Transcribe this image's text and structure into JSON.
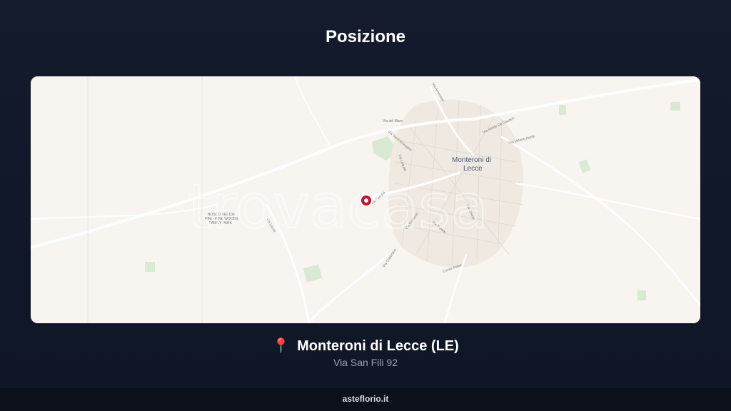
{
  "header": {
    "title": "Posizione"
  },
  "map": {
    "watermark": "trovacasa",
    "town_label_line1": "Monteroni di",
    "town_label_line2": "Lecce",
    "park_label_line1": "BOSCO DEI 100",
    "park_label_line2": "PINI - PINE WOODS",
    "park_label_line3": "FAMILY PARK",
    "streets": [
      "Via del Mare",
      "Via San Fili",
      "Via Alcide De Gasperi",
      "Via Vittorio Aprile",
      "Via Lequile",
      "Via Sant'Arcangelo",
      "Via Copertino",
      "Corso Ameo",
      "Via Trieste",
      "Via Arnesano",
      "Via Carducci",
      "Via Cavour",
      "Via Lecce"
    ],
    "marker_icon": "location-pin",
    "colors": {
      "map_background": "#f8f4f0",
      "marker": "#c8102e"
    }
  },
  "location": {
    "pin_icon": "round-pushpin",
    "town": "Monteroni di Lecce (LE)",
    "address": "Via San Fili 92"
  },
  "footer": {
    "brand": "asteflorio.it"
  },
  "colors": {
    "background": "#131b2c",
    "footer_background": "#0b101b",
    "address_text": "#9aa4b5"
  }
}
